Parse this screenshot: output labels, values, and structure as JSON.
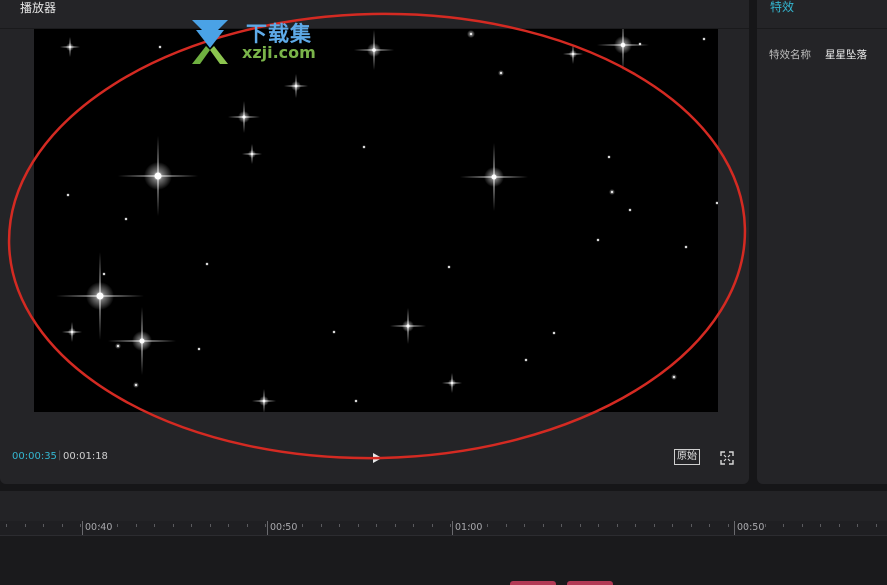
{
  "player": {
    "title": "播放器",
    "time_current": "00:00:35",
    "time_separator": "|",
    "time_total": "00:01:18",
    "ratio_label": "原始"
  },
  "effect_panel": {
    "tab_label": "特效",
    "name_label": "特效名称",
    "name_value": "星星坠落"
  },
  "timeline": {
    "ruler_labels": [
      "00:40",
      "00:50",
      "01:00",
      "00:50"
    ]
  },
  "watermark": {
    "title": "下载集",
    "domain": "xzji.com"
  },
  "colors": {
    "accent": "#34b6d0",
    "annotation": "#d42a22",
    "clip": "#b23a55"
  },
  "icons": {
    "play": "play-icon",
    "fullscreen": "fullscreen-icon",
    "watermark": "download-arrow-icon"
  }
}
